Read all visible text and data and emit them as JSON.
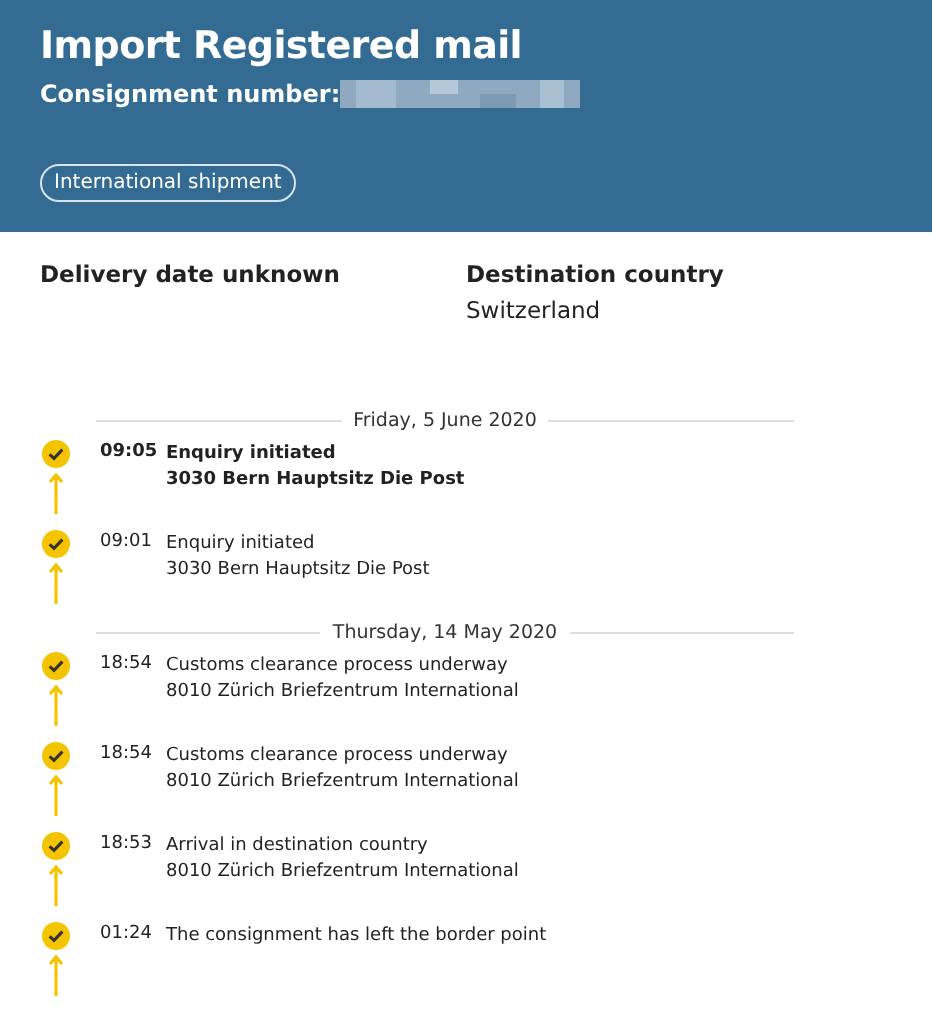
{
  "header": {
    "title": "Import Registered mail",
    "consignment_label": "Consignment number:",
    "tag": "International shipment"
  },
  "details": [
    {
      "label": "Delivery date unknown"
    },
    {
      "label": "Destination country",
      "value": "Switzerland"
    }
  ],
  "timeline": [
    {
      "date": "Friday, 5 June 2020",
      "events": [
        {
          "time": "09:05",
          "status": "Enquiry initiated",
          "location": "3030 Bern Hauptsitz Die Post",
          "latest": true
        },
        {
          "time": "09:01",
          "status": "Enquiry initiated",
          "location": "3030 Bern Hauptsitz Die Post",
          "latest": false
        }
      ]
    },
    {
      "date": "Thursday, 14 May 2020",
      "events": [
        {
          "time": "18:54",
          "status": "Customs clearance process underway",
          "location": "8010 Zürich Briefzentrum International",
          "latest": false
        },
        {
          "time": "18:54",
          "status": "Customs clearance process underway",
          "location": "8010 Zürich Briefzentrum International",
          "latest": false
        },
        {
          "time": "18:53",
          "status": "Arrival in destination country",
          "location": "8010 Zürich Briefzentrum International",
          "latest": false
        },
        {
          "time": "01:24",
          "status": "The consignment has left the border point",
          "latest": false
        }
      ]
    }
  ]
}
